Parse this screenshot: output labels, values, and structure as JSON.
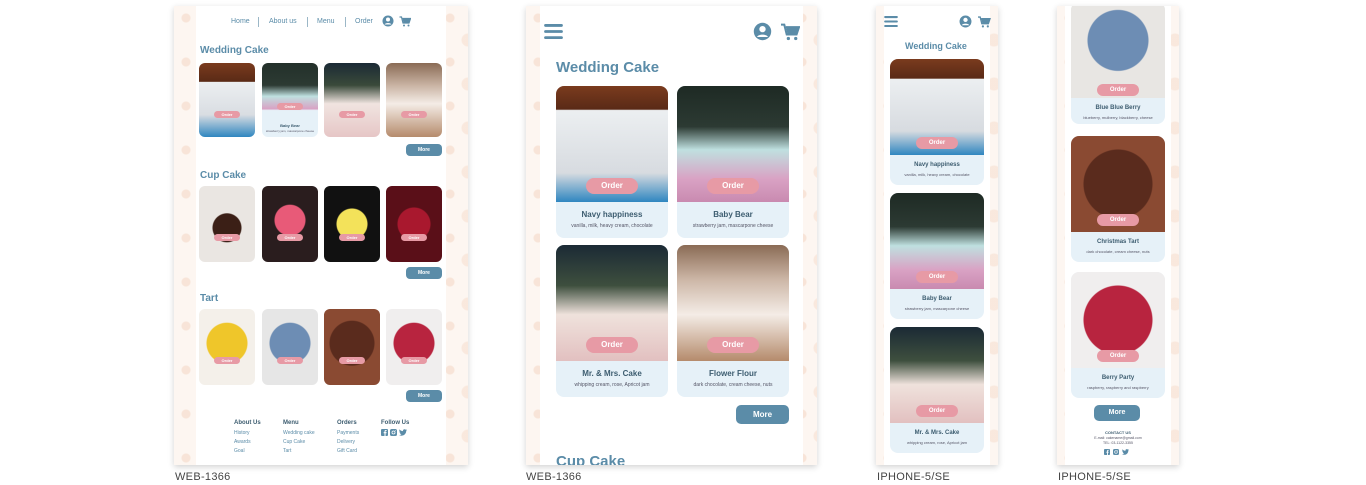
{
  "frames": [
    {
      "label": "WEB-1366"
    },
    {
      "label": "WEB-1366"
    },
    {
      "label": "IPHONE-5/SE"
    },
    {
      "label": "IPHONE-5/SE"
    }
  ],
  "nav": {
    "home": "Home",
    "about": "About us",
    "menu": "Menu",
    "order": "Order"
  },
  "sections": {
    "wedding": "Wedding Cake",
    "cupcake": "Cup Cake",
    "tart": "Tart"
  },
  "buttons": {
    "order": "Order",
    "more": "More"
  },
  "cakes": {
    "navy": {
      "name": "Navy happiness",
      "desc": "vanilla, milk, heavy cream, chocolate"
    },
    "bear": {
      "name": "Baby Bear",
      "desc": "strawberry jam, mascarpone cheese"
    },
    "mrs": {
      "name": "Mr. & Mrs. Cake",
      "desc": "whipping cream, rose, Apricot jam"
    },
    "flower": {
      "name": "Flower Flour",
      "desc": "dark chocolate, cream cheese, nuts"
    },
    "blueberry": {
      "name": "Blue Blue Berry",
      "desc": "blueberry, mulberry, blackberry, cheese"
    },
    "xmas": {
      "name": "Christmas Tart",
      "desc": "dark chocolate, cream cheese, nuts"
    },
    "berry": {
      "name": "Berry Party",
      "desc": "raspberry, raspberry and raspberry"
    }
  },
  "footer": {
    "about": {
      "title": "About Us",
      "items": [
        "History",
        "Awards",
        "Goal"
      ]
    },
    "menu": {
      "title": "Menu",
      "items": [
        "Wedding cake",
        "Cup Cake",
        "Tart"
      ]
    },
    "orders": {
      "title": "Orders",
      "items": [
        "Payments",
        "Delivery",
        "Gift Card"
      ]
    },
    "follow": {
      "title": "Follow Us"
    }
  },
  "contact": {
    "title": "CONTACT US",
    "email": "E-mail: cakename@gmail.com",
    "tel": "TEL: 03-1122-3355"
  },
  "colors": {
    "accent": "#5b8ca8",
    "order_pill": "#e79aa5",
    "card_bg": "#e6f1f8",
    "lace": "#fdf6f1"
  },
  "icons": [
    "user-icon",
    "cart-icon",
    "menu-icon",
    "facebook-icon",
    "instagram-icon",
    "twitter-icon"
  ]
}
